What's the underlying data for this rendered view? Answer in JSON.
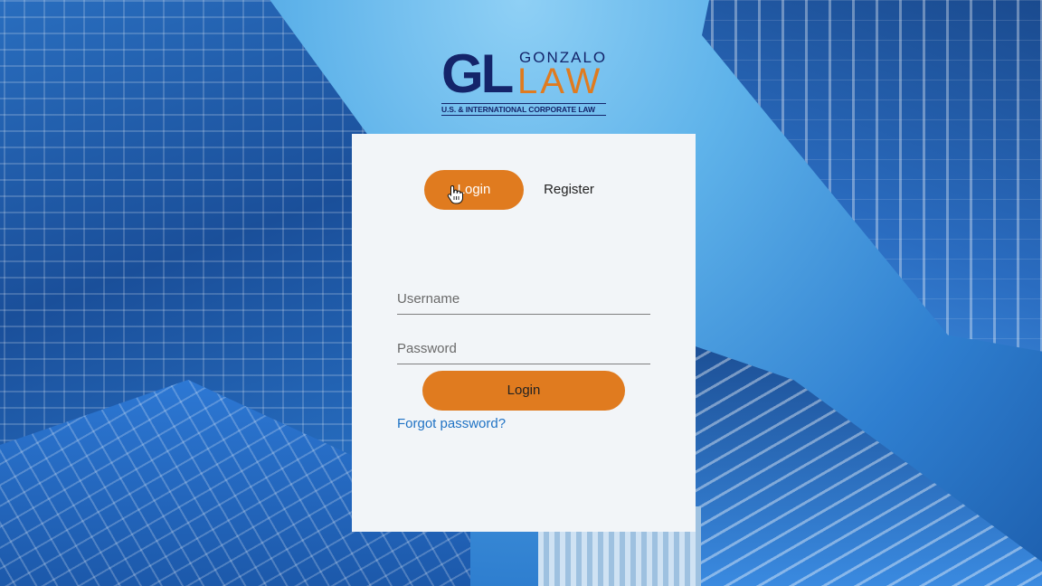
{
  "logo": {
    "initials": "GL",
    "name_top": "GONZALO",
    "name_bottom": "LAW",
    "tagline": "U.S. & INTERNATIONAL CORPORATE LAW"
  },
  "tabs": {
    "login_label": "Login",
    "register_label": "Register"
  },
  "form": {
    "username_placeholder": "Username",
    "password_placeholder": "Password",
    "submit_label": "Login",
    "forgot_label": "Forgot password?"
  },
  "colors": {
    "accent": "#e07b1f",
    "brand_navy": "#14246a",
    "link": "#1f72c4",
    "card_bg": "#f2f5f8"
  },
  "icons": {
    "cursor": "hand-pointer-icon"
  }
}
